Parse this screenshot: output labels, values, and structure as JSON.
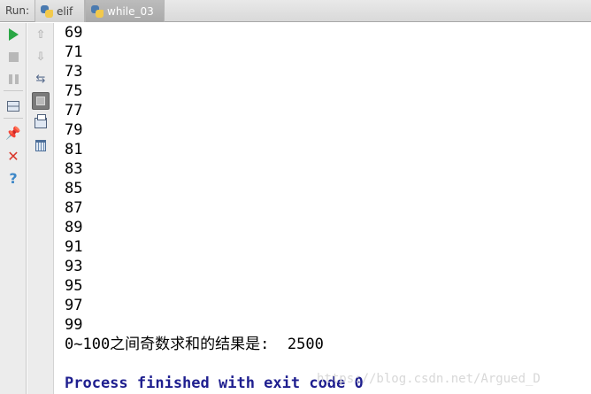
{
  "tabbar": {
    "run_label": "Run:",
    "tabs": [
      {
        "label": "elif",
        "active": false
      },
      {
        "label": "while_03",
        "active": true
      }
    ]
  },
  "console": {
    "numbers": [
      "69",
      "71",
      "73",
      "75",
      "77",
      "79",
      "81",
      "83",
      "85",
      "87",
      "89",
      "91",
      "93",
      "95",
      "97",
      "99"
    ],
    "result_line": "0~100之间奇数求和的结果是:  2500",
    "exit_line": "Process finished with exit code 0"
  },
  "watermark": "https://blog.csdn.net/Argued_D",
  "colors": {
    "run_green": "#2aa745",
    "close_red": "#d9362a",
    "process_text": "#1f1f8f"
  }
}
